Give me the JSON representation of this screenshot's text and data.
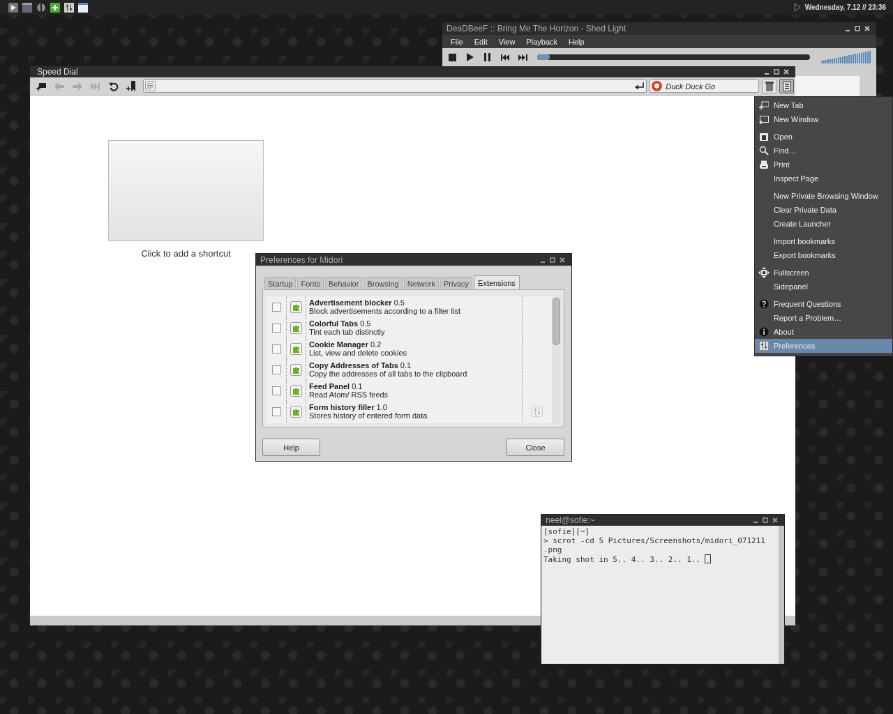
{
  "top_panel": {
    "clock": "Wednesday,  7.12 // 23:36"
  },
  "player": {
    "title": "DeaDBeeF :: Bring Me The Horizon - Shed Light",
    "menu": [
      "File",
      "Edit",
      "View",
      "Playback",
      "Help"
    ],
    "seek": {
      "level": 0.045
    },
    "volume": {
      "level": 1
    }
  },
  "browser": {
    "title": "Speed Dial",
    "nav_buttons": [
      {
        "disabled": false
      },
      {
        "disabled": true
      },
      {
        "disabled": true
      },
      {
        "disabled": true
      },
      {
        "disabled": false
      },
      {
        "disabled": false
      }
    ],
    "search": {
      "placeholder": "Duck Duck Go"
    },
    "menu_button": {
      "pressed": true
    },
    "speed_dial": [
      {
        "caption": "Click to add a shortcut"
      }
    ]
  },
  "app_menu": {
    "groups": [
      [
        {
          "label": "New Tab",
          "selected": false
        },
        {
          "label": "New Window",
          "selected": false
        }
      ],
      [
        {
          "label": "Open",
          "selected": false
        },
        {
          "label": "Find…",
          "selected": false
        },
        {
          "label": "Print",
          "selected": false
        },
        {
          "label": "Inspect Page",
          "selected": false
        }
      ],
      [
        {
          "label": "New Private Browsing Window",
          "selected": false
        },
        {
          "label": "Clear Private Data",
          "selected": false
        },
        {
          "label": "Create Launcher",
          "selected": false
        }
      ],
      [
        {
          "label": "Import bookmarks",
          "selected": false
        },
        {
          "label": "Export bookmarks",
          "selected": false
        }
      ],
      [
        {
          "label": "Fullscreen",
          "selected": false
        },
        {
          "label": "Sidepanel",
          "selected": false
        }
      ],
      [
        {
          "label": "Frequent Questions",
          "selected": false
        },
        {
          "label": "Report a Problem…",
          "selected": false
        },
        {
          "label": "About",
          "selected": false
        },
        {
          "label": "Preferences",
          "selected": true
        }
      ]
    ]
  },
  "preferences": {
    "title": "Preferences for Midori",
    "tabs": [
      {
        "label": "Startup",
        "selected": false
      },
      {
        "label": "Fonts",
        "selected": false
      },
      {
        "label": "Behavior",
        "selected": false
      },
      {
        "label": "Browsing",
        "selected": false
      },
      {
        "label": "Network",
        "selected": false
      },
      {
        "label": "Privacy",
        "selected": false
      },
      {
        "label": "Extensions",
        "selected": true
      }
    ],
    "extensions": [
      {
        "checked": false,
        "name": "**Advertisement blocker** 0.5",
        "description": "Block advertisements according to a filter list",
        "has_settings": false
      },
      {
        "checked": false,
        "name": "**Colorful Tabs** 0.5",
        "description": "Tint each tab distinctly",
        "has_settings": false
      },
      {
        "checked": false,
        "name": "**Cookie Manager** 0.2",
        "description": "List, view and delete cookies",
        "has_settings": false
      },
      {
        "checked": false,
        "name": "**Copy Addresses of Tabs** 0.1",
        "description": "Copy the addresses of all tabs to the clipboard",
        "has_settings": false
      },
      {
        "checked": false,
        "name": "**Feed Panel** 0.1",
        "description": "Read Atom/ RSS feeds",
        "has_settings": false
      },
      {
        "checked": false,
        "name": "**Form history filler** 1.0",
        "description": "Stores history of entered form data",
        "has_settings": true
      }
    ],
    "buttons": [
      "Help",
      "Close"
    ]
  },
  "terminal": {
    "title": "neel@sofie:~",
    "lines": [
      "[sofie][~]",
      "> scrot -cd 5 Pictures/Screenshots/midori_071211",
      ".png",
      "Taking shot in 5.. 4.. 3.. 2.. 1.."
    ]
  }
}
